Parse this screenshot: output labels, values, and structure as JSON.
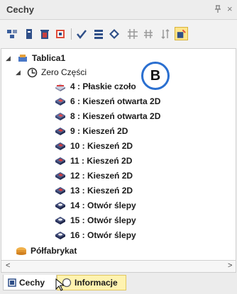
{
  "panel": {
    "title": "Cechy",
    "pin_label": "ᵖ",
    "close_label": "×"
  },
  "toolbar": {
    "tools": [
      "tree-icon",
      "bookmark-icon",
      "trash-icon",
      "check-tool-icon",
      "list-tool-icon",
      "diamond-icon",
      "grid-icon",
      "hash-icon",
      "sort-icon",
      "feature-settings-icon"
    ]
  },
  "badge": {
    "letter": "B"
  },
  "tree": {
    "root": {
      "label": "Tablica1"
    },
    "group": {
      "label": "Zero Części"
    },
    "items": [
      {
        "label": "4 :  Płaskie czoło",
        "icon": "face-icon"
      },
      {
        "label": "6 :  Kieszeń otwarta 2D",
        "icon": "open-pocket-icon"
      },
      {
        "label": "8 :  Kieszeń otwarta 2D",
        "icon": "open-pocket-icon"
      },
      {
        "label": "9 :  Kieszeń 2D",
        "icon": "pocket-icon"
      },
      {
        "label": "10 :  Kieszeń 2D",
        "icon": "pocket-icon"
      },
      {
        "label": "11 :  Kieszeń 2D",
        "icon": "pocket-icon"
      },
      {
        "label": "12 :  Kieszeń 2D",
        "icon": "pocket-icon"
      },
      {
        "label": "13 :  Kieszeń 2D",
        "icon": "pocket-icon"
      },
      {
        "label": "14 :  Otwór ślepy",
        "icon": "blind-hole-icon"
      },
      {
        "label": "15 :  Otwór ślepy",
        "icon": "blind-hole-icon"
      },
      {
        "label": "16 :  Otwór ślepy",
        "icon": "blind-hole-icon"
      }
    ],
    "stock": {
      "label": "Półfabrykat"
    }
  },
  "tabs": {
    "cechy": "Cechy",
    "informacje": "Informacje"
  }
}
